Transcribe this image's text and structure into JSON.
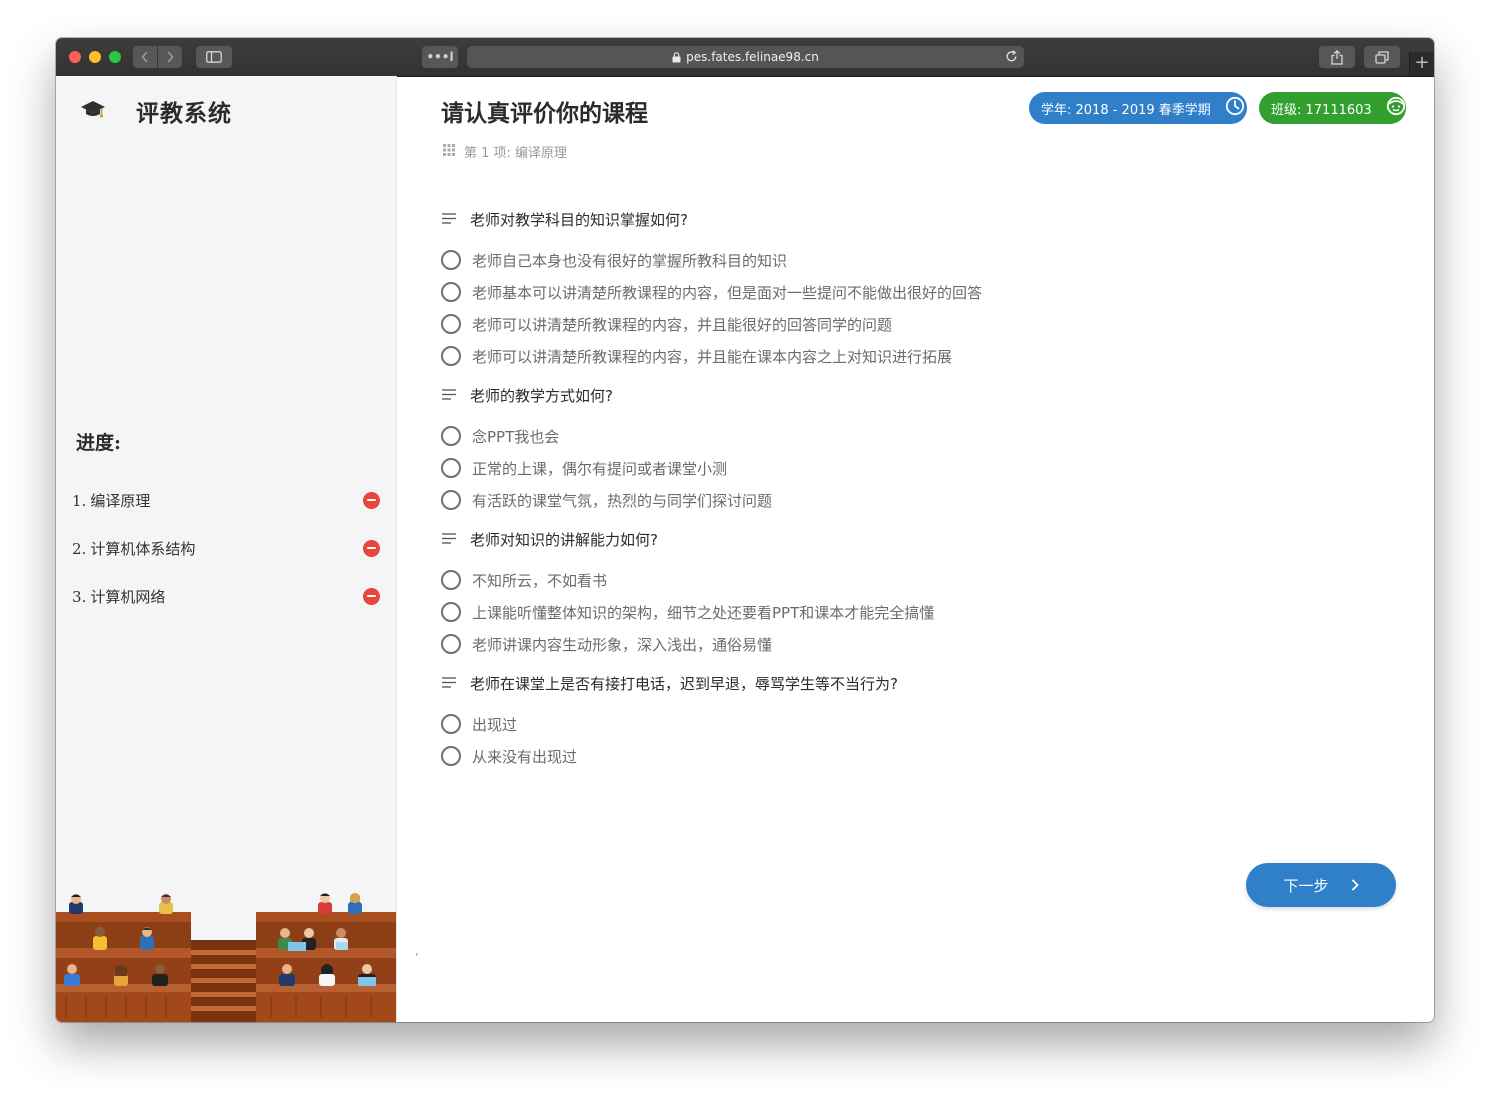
{
  "browser": {
    "url": "pes.fates.felinae98.cn",
    "tabs_dots": "•••l",
    "new_tab": "+"
  },
  "sidebar": {
    "brand_title": "评教系统",
    "progress_title": "进度:",
    "items": [
      {
        "index": "1.",
        "label": "编译原理"
      },
      {
        "index": "2.",
        "label": "计算机体系结构"
      },
      {
        "index": "3.",
        "label": "计算机网络"
      }
    ]
  },
  "header": {
    "title": "请认真评价你的课程",
    "breadcrumb": "第 1 项:  编译原理",
    "term_badge": "学年:  2018 - 2019 春季学期",
    "class_badge": "班级:  17111603"
  },
  "questions": [
    {
      "title": "老师对教学科目的知识掌握如何?",
      "options": [
        "老师自己本身也没有很好的掌握所教科目的知识",
        "老师基本可以讲清楚所教课程的内容，但是面对一些提问不能做出很好的回答",
        "老师可以讲清楚所教课程的内容，并且能很好的回答同学的问题",
        "老师可以讲清楚所教课程的内容，并且能在课本内容之上对知识进行拓展"
      ]
    },
    {
      "title": "老师的教学方式如何?",
      "options": [
        "念PPT我也会",
        "正常的上课，偶尔有提问或者课堂小测",
        "有活跃的课堂气氛，热烈的与同学们探讨问题"
      ]
    },
    {
      "title": "老师对知识的讲解能力如何?",
      "options": [
        "不知所云，不如看书",
        "上课能听懂整体知识的架构，细节之处还要看PPT和课本才能完全搞懂",
        "老师讲课内容生动形象，深入浅出，通俗易懂"
      ]
    },
    {
      "title": "老师在课堂上是否有接打电话，迟到早退，辱骂学生等不当行为?",
      "options": [
        "出现过",
        "从来没有出现过"
      ]
    }
  ],
  "actions": {
    "next_label": "下一步"
  },
  "stray_mark": "ʳ",
  "colors": {
    "primary_blue": "#2f7fc9",
    "class_green": "#32a02f",
    "status_red": "#e8453c",
    "sidebar_bg": "#f4f5f7"
  },
  "icons": {
    "brand": "graduation-cap-icon",
    "term": "clock-icon",
    "class": "smiley-face-icon",
    "question": "menu-lines-icon",
    "breadcrumb": "grid-icon",
    "status": "minus-circle-icon",
    "next": "chevron-right-icon"
  }
}
